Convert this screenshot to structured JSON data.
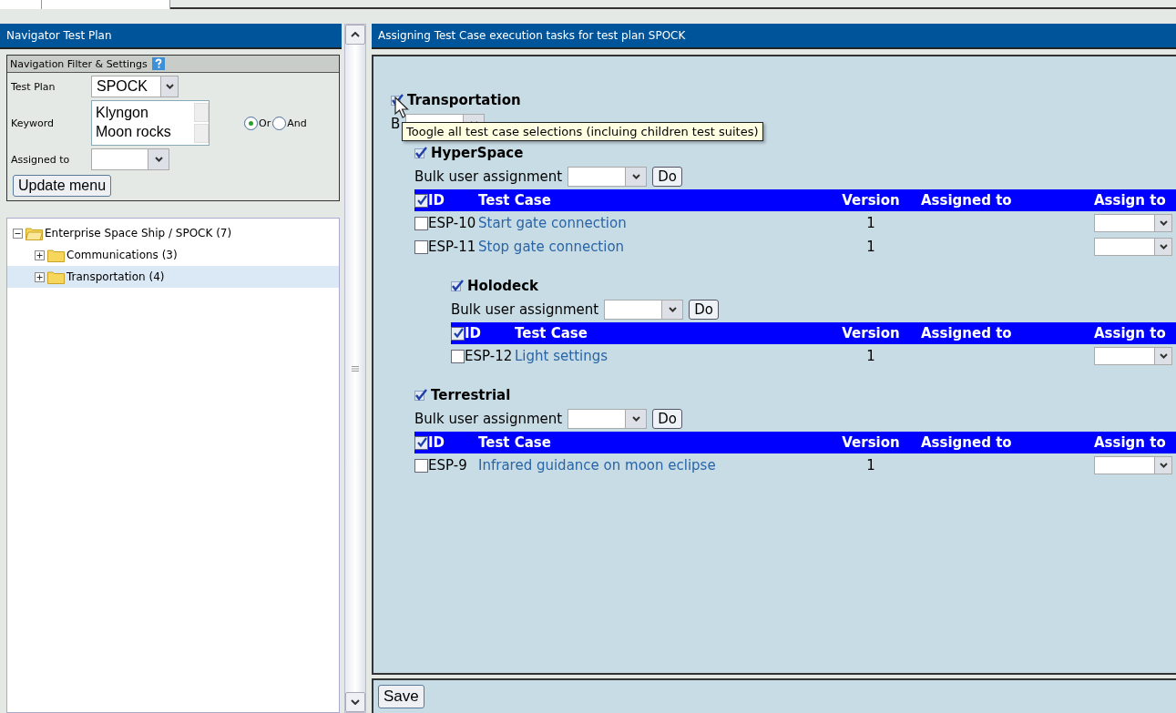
{
  "navigator": {
    "title": "Navigator Test Plan",
    "filter": {
      "title": "Navigation Filter & Settings",
      "test_plan_label": "Test Plan",
      "test_plan_value": "SPOCK",
      "keyword_label": "Keyword",
      "keywords": [
        "Klyngon",
        "Moon rocks"
      ],
      "logic": [
        {
          "label": "Or",
          "selected": true
        },
        {
          "label": "And",
          "selected": false
        }
      ],
      "assigned_label": "Assigned to",
      "update_button": "Update menu"
    },
    "tree": [
      {
        "label": "Enterprise Space Ship / SPOCK (7)",
        "expanded": true,
        "selected": false,
        "children": [
          {
            "label": "Communications (3)",
            "expanded": false,
            "selected": false
          },
          {
            "label": "Transportation (4)",
            "expanded": false,
            "selected": true
          }
        ]
      }
    ]
  },
  "main": {
    "title": "Assigning Test Case execution tasks for test plan SPOCK",
    "suites": [
      {
        "name": "Transportation",
        "checked": true,
        "bulk_label": "B",
        "tooltip": "Toogle all test case selections (incluing children test suites)",
        "children": [
          {
            "name": "HyperSpace",
            "checked": true,
            "bulk_label": "Bulk user assignment",
            "do_button": "Do",
            "table": {
              "columns": [
                "ID",
                "Test Case",
                "Version",
                "Assigned to",
                "Assign to"
              ],
              "all_checked": true,
              "rows": [
                {
                  "id": "ESP-10",
                  "title": "Start gate connection",
                  "version": "1",
                  "selected": false
                },
                {
                  "id": "ESP-11",
                  "title": "Stop gate connection",
                  "version": "1",
                  "selected": false
                }
              ]
            },
            "children": [
              {
                "name": "Holodeck",
                "checked": true,
                "bulk_label": "Bulk user assignment",
                "do_button": "Do",
                "table": {
                  "columns": [
                    "ID",
                    "Test Case",
                    "Version",
                    "Assigned to",
                    "Assign to"
                  ],
                  "all_checked": true,
                  "rows": [
                    {
                      "id": "ESP-12",
                      "title": "Light settings",
                      "version": "1",
                      "selected": false
                    }
                  ]
                }
              }
            ]
          },
          {
            "name": "Terrestrial",
            "checked": true,
            "bulk_label": "Bulk user assignment",
            "do_button": "Do",
            "table": {
              "columns": [
                "ID",
                "Test Case",
                "Version",
                "Assigned to",
                "Assign to"
              ],
              "all_checked": true,
              "rows": [
                {
                  "id": "ESP-9",
                  "title": "Infrared guidance on moon eclipse",
                  "version": "1",
                  "selected": false
                }
              ]
            }
          }
        ]
      }
    ],
    "save_button": "Save"
  }
}
